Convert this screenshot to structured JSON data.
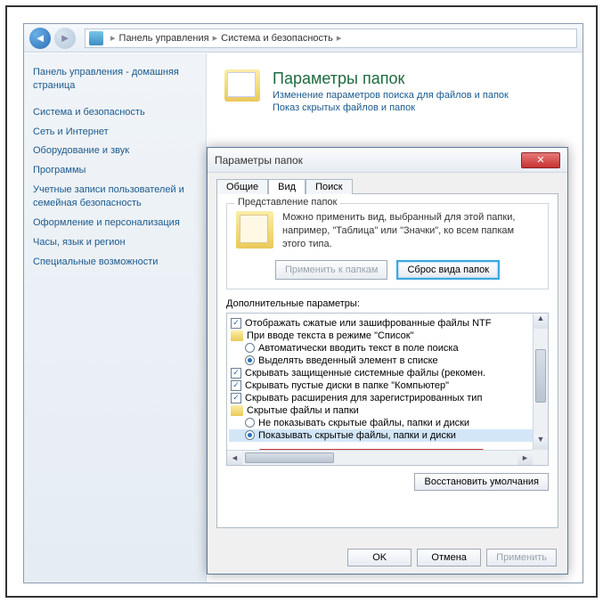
{
  "nav": {
    "crumb1": "Панель управления",
    "crumb2": "Система и безопасность"
  },
  "sidebar": {
    "home": "Панель управления - домашняя страница",
    "links": [
      "Система и безопасность",
      "Сеть и Интернет",
      "Оборудование и звук",
      "Программы",
      "Учетные записи пользователей и семейная безопасность",
      "Оформление и персонализация",
      "Часы, язык и регион",
      "Специальные возможности"
    ]
  },
  "main": {
    "title": "Параметры папок",
    "sub1": "Изменение параметров поиска для файлов и папок",
    "sub2": "Показ скрытых файлов и папок"
  },
  "dialog": {
    "title": "Параметры папок",
    "tabs": {
      "t0": "Общие",
      "t1": "Вид",
      "t2": "Поиск"
    },
    "group": {
      "title": "Представление папок",
      "text": "Можно применить вид, выбранный для этой папки, например, \"Таблица\" или \"Значки\", ко всем папкам этого типа.",
      "apply": "Применить к папкам",
      "reset": "Сброс вида папок"
    },
    "adv_label": "Дополнительные параметры:",
    "adv": {
      "i0": "Отображать сжатые или зашифрованные файлы NTF",
      "i1": "При вводе текста в режиме \"Список\"",
      "i2": "Автоматически вводить текст в поле поиска",
      "i3": "Выделять введенный элемент в списке",
      "i4": "Скрывать защищенные системные файлы (рекомен.",
      "i5": "Скрывать пустые диски в папке \"Компьютер\"",
      "i6": "Скрывать расширения для зарегистрированных тип",
      "i7": "Скрытые файлы и папки",
      "i8": "Не показывать скрытые файлы, папки и диски",
      "i9": "Показывать скрытые файлы, папки и диски"
    },
    "restore": "Восстановить умолчания",
    "ok": "OK",
    "cancel": "Отмена",
    "apply_btn": "Применить"
  }
}
